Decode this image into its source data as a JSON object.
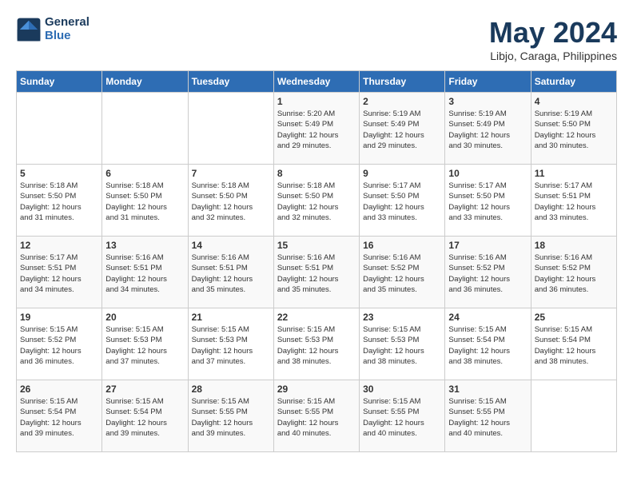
{
  "logo": {
    "line1": "General",
    "line2": "Blue"
  },
  "title": "May 2024",
  "subtitle": "Libjo, Caraga, Philippines",
  "days_of_week": [
    "Sunday",
    "Monday",
    "Tuesday",
    "Wednesday",
    "Thursday",
    "Friday",
    "Saturday"
  ],
  "weeks": [
    [
      {
        "num": "",
        "info": ""
      },
      {
        "num": "",
        "info": ""
      },
      {
        "num": "",
        "info": ""
      },
      {
        "num": "1",
        "info": "Sunrise: 5:20 AM\nSunset: 5:49 PM\nDaylight: 12 hours\nand 29 minutes."
      },
      {
        "num": "2",
        "info": "Sunrise: 5:19 AM\nSunset: 5:49 PM\nDaylight: 12 hours\nand 29 minutes."
      },
      {
        "num": "3",
        "info": "Sunrise: 5:19 AM\nSunset: 5:49 PM\nDaylight: 12 hours\nand 30 minutes."
      },
      {
        "num": "4",
        "info": "Sunrise: 5:19 AM\nSunset: 5:50 PM\nDaylight: 12 hours\nand 30 minutes."
      }
    ],
    [
      {
        "num": "5",
        "info": "Sunrise: 5:18 AM\nSunset: 5:50 PM\nDaylight: 12 hours\nand 31 minutes."
      },
      {
        "num": "6",
        "info": "Sunrise: 5:18 AM\nSunset: 5:50 PM\nDaylight: 12 hours\nand 31 minutes."
      },
      {
        "num": "7",
        "info": "Sunrise: 5:18 AM\nSunset: 5:50 PM\nDaylight: 12 hours\nand 32 minutes."
      },
      {
        "num": "8",
        "info": "Sunrise: 5:18 AM\nSunset: 5:50 PM\nDaylight: 12 hours\nand 32 minutes."
      },
      {
        "num": "9",
        "info": "Sunrise: 5:17 AM\nSunset: 5:50 PM\nDaylight: 12 hours\nand 33 minutes."
      },
      {
        "num": "10",
        "info": "Sunrise: 5:17 AM\nSunset: 5:50 PM\nDaylight: 12 hours\nand 33 minutes."
      },
      {
        "num": "11",
        "info": "Sunrise: 5:17 AM\nSunset: 5:51 PM\nDaylight: 12 hours\nand 33 minutes."
      }
    ],
    [
      {
        "num": "12",
        "info": "Sunrise: 5:17 AM\nSunset: 5:51 PM\nDaylight: 12 hours\nand 34 minutes."
      },
      {
        "num": "13",
        "info": "Sunrise: 5:16 AM\nSunset: 5:51 PM\nDaylight: 12 hours\nand 34 minutes."
      },
      {
        "num": "14",
        "info": "Sunrise: 5:16 AM\nSunset: 5:51 PM\nDaylight: 12 hours\nand 35 minutes."
      },
      {
        "num": "15",
        "info": "Sunrise: 5:16 AM\nSunset: 5:51 PM\nDaylight: 12 hours\nand 35 minutes."
      },
      {
        "num": "16",
        "info": "Sunrise: 5:16 AM\nSunset: 5:52 PM\nDaylight: 12 hours\nand 35 minutes."
      },
      {
        "num": "17",
        "info": "Sunrise: 5:16 AM\nSunset: 5:52 PM\nDaylight: 12 hours\nand 36 minutes."
      },
      {
        "num": "18",
        "info": "Sunrise: 5:16 AM\nSunset: 5:52 PM\nDaylight: 12 hours\nand 36 minutes."
      }
    ],
    [
      {
        "num": "19",
        "info": "Sunrise: 5:15 AM\nSunset: 5:52 PM\nDaylight: 12 hours\nand 36 minutes."
      },
      {
        "num": "20",
        "info": "Sunrise: 5:15 AM\nSunset: 5:53 PM\nDaylight: 12 hours\nand 37 minutes."
      },
      {
        "num": "21",
        "info": "Sunrise: 5:15 AM\nSunset: 5:53 PM\nDaylight: 12 hours\nand 37 minutes."
      },
      {
        "num": "22",
        "info": "Sunrise: 5:15 AM\nSunset: 5:53 PM\nDaylight: 12 hours\nand 38 minutes."
      },
      {
        "num": "23",
        "info": "Sunrise: 5:15 AM\nSunset: 5:53 PM\nDaylight: 12 hours\nand 38 minutes."
      },
      {
        "num": "24",
        "info": "Sunrise: 5:15 AM\nSunset: 5:54 PM\nDaylight: 12 hours\nand 38 minutes."
      },
      {
        "num": "25",
        "info": "Sunrise: 5:15 AM\nSunset: 5:54 PM\nDaylight: 12 hours\nand 38 minutes."
      }
    ],
    [
      {
        "num": "26",
        "info": "Sunrise: 5:15 AM\nSunset: 5:54 PM\nDaylight: 12 hours\nand 39 minutes."
      },
      {
        "num": "27",
        "info": "Sunrise: 5:15 AM\nSunset: 5:54 PM\nDaylight: 12 hours\nand 39 minutes."
      },
      {
        "num": "28",
        "info": "Sunrise: 5:15 AM\nSunset: 5:55 PM\nDaylight: 12 hours\nand 39 minutes."
      },
      {
        "num": "29",
        "info": "Sunrise: 5:15 AM\nSunset: 5:55 PM\nDaylight: 12 hours\nand 40 minutes."
      },
      {
        "num": "30",
        "info": "Sunrise: 5:15 AM\nSunset: 5:55 PM\nDaylight: 12 hours\nand 40 minutes."
      },
      {
        "num": "31",
        "info": "Sunrise: 5:15 AM\nSunset: 5:55 PM\nDaylight: 12 hours\nand 40 minutes."
      },
      {
        "num": "",
        "info": ""
      }
    ]
  ]
}
